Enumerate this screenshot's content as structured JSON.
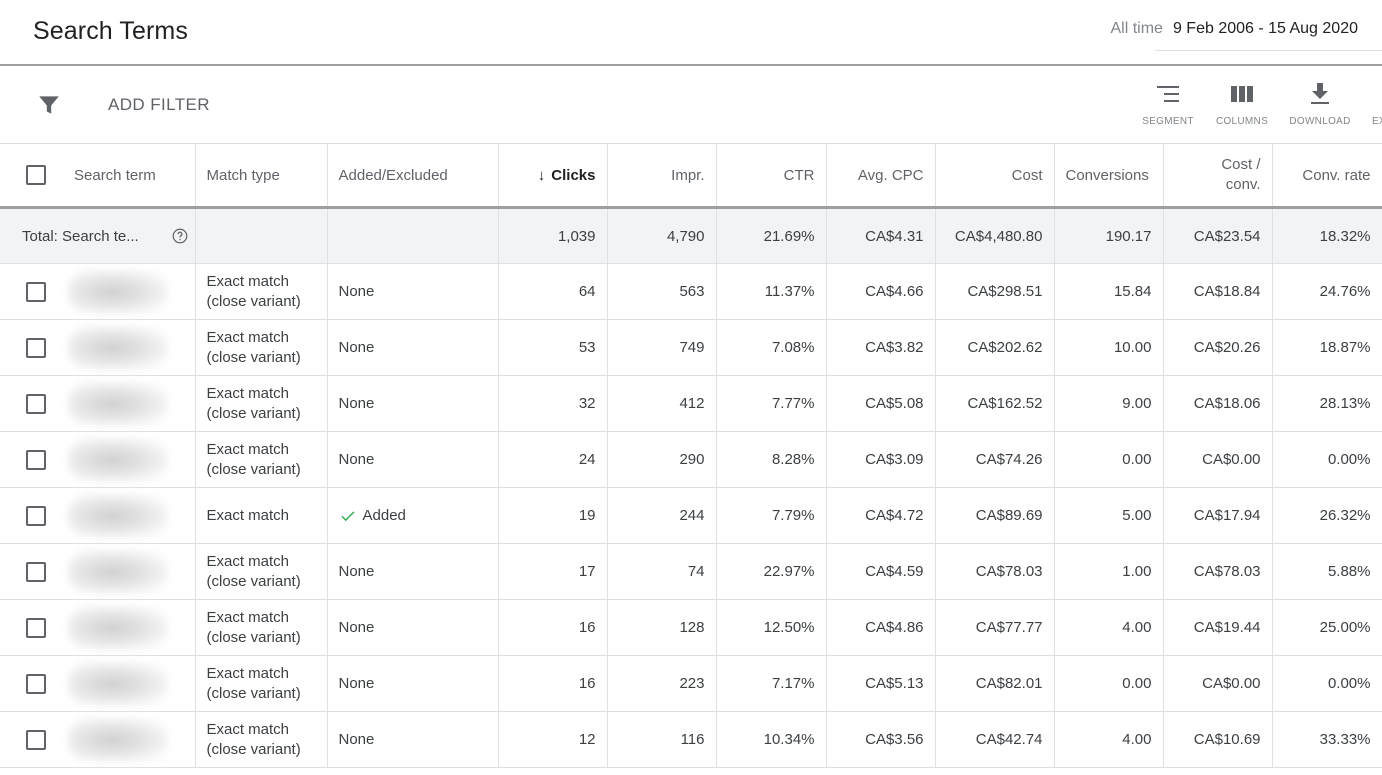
{
  "header": {
    "title": "Search Terms",
    "date_preset": "All time",
    "date_range": "9 Feb 2006 - 15 Aug 2020"
  },
  "toolbar": {
    "add_filter_label": "ADD FILTER",
    "filter_icon": "filter-funnel-icon",
    "tools": [
      {
        "label": "SEGMENT",
        "icon": "segment-icon"
      },
      {
        "label": "COLUMNS",
        "icon": "columns-icon"
      },
      {
        "label": "DOWNLOAD",
        "icon": "download-icon"
      },
      {
        "label": "EXPAND",
        "icon": "expand-icon"
      }
    ]
  },
  "table": {
    "columns": {
      "search_term": "Search term",
      "match_type": "Match type",
      "added_excluded": "Added/Excluded",
      "clicks": "Clicks",
      "impr": "Impr.",
      "ctr": "CTR",
      "avg_cpc": "Avg. CPC",
      "cost": "Cost",
      "conversions": "Conversions",
      "cost_conv": "Cost / conv.",
      "conv_rate": "Conv. rate"
    },
    "sort": {
      "column": "clicks",
      "direction": "descending"
    },
    "total": {
      "label": "Total: Search te...",
      "clicks": "1,039",
      "impr": "4,790",
      "ctr": "21.69%",
      "avg_cpc": "CA$4.31",
      "cost": "CA$4,480.80",
      "conversions": "190.17",
      "cost_conv": "CA$23.54",
      "conv_rate": "18.32%"
    },
    "rows": [
      {
        "search_term": "[blurred]",
        "match_type": "Exact match (close variant)",
        "added_excluded": "None",
        "clicks": "64",
        "impr": "563",
        "ctr": "11.37%",
        "avg_cpc": "CA$4.66",
        "cost": "CA$298.51",
        "conversions": "15.84",
        "cost_conv": "CA$18.84",
        "conv_rate": "24.76%"
      },
      {
        "search_term": "[blurred]",
        "match_type": "Exact match (close variant)",
        "added_excluded": "None",
        "clicks": "53",
        "impr": "749",
        "ctr": "7.08%",
        "avg_cpc": "CA$3.82",
        "cost": "CA$202.62",
        "conversions": "10.00",
        "cost_conv": "CA$20.26",
        "conv_rate": "18.87%"
      },
      {
        "search_term": "[blurred]",
        "match_type": "Exact match (close variant)",
        "added_excluded": "None",
        "clicks": "32",
        "impr": "412",
        "ctr": "7.77%",
        "avg_cpc": "CA$5.08",
        "cost": "CA$162.52",
        "conversions": "9.00",
        "cost_conv": "CA$18.06",
        "conv_rate": "28.13%"
      },
      {
        "search_term": "[blurred]",
        "match_type": "Exact match (close variant)",
        "added_excluded": "None",
        "clicks": "24",
        "impr": "290",
        "ctr": "8.28%",
        "avg_cpc": "CA$3.09",
        "cost": "CA$74.26",
        "conversions": "0.00",
        "cost_conv": "CA$0.00",
        "conv_rate": "0.00%"
      },
      {
        "search_term": "[blurred]",
        "match_type": "Exact match",
        "added_excluded": "Added",
        "added": true,
        "clicks": "19",
        "impr": "244",
        "ctr": "7.79%",
        "avg_cpc": "CA$4.72",
        "cost": "CA$89.69",
        "conversions": "5.00",
        "cost_conv": "CA$17.94",
        "conv_rate": "26.32%"
      },
      {
        "search_term": "[blurred]",
        "match_type": "Exact match (close variant)",
        "added_excluded": "None",
        "clicks": "17",
        "impr": "74",
        "ctr": "22.97%",
        "avg_cpc": "CA$4.59",
        "cost": "CA$78.03",
        "conversions": "1.00",
        "cost_conv": "CA$78.03",
        "conv_rate": "5.88%"
      },
      {
        "search_term": "[blurred]",
        "match_type": "Exact match (close variant)",
        "added_excluded": "None",
        "clicks": "16",
        "impr": "128",
        "ctr": "12.50%",
        "avg_cpc": "CA$4.86",
        "cost": "CA$77.77",
        "conversions": "4.00",
        "cost_conv": "CA$19.44",
        "conv_rate": "25.00%"
      },
      {
        "search_term": "[blurred]",
        "match_type": "Exact match (close variant)",
        "added_excluded": "None",
        "clicks": "16",
        "impr": "223",
        "ctr": "7.17%",
        "avg_cpc": "CA$5.13",
        "cost": "CA$82.01",
        "conversions": "0.00",
        "cost_conv": "CA$0.00",
        "conv_rate": "0.00%"
      },
      {
        "search_term": "[blurred]",
        "match_type": "Exact match (close variant)",
        "added_excluded": "None",
        "clicks": "12",
        "impr": "116",
        "ctr": "10.34%",
        "avg_cpc": "CA$3.56",
        "cost": "CA$42.74",
        "conversions": "4.00",
        "cost_conv": "CA$10.69",
        "conv_rate": "33.33%"
      }
    ]
  },
  "colors": {
    "added_check": "#34a853",
    "total_row_bg": "#f1f3f4",
    "header_divider": "#9e9e9e"
  }
}
